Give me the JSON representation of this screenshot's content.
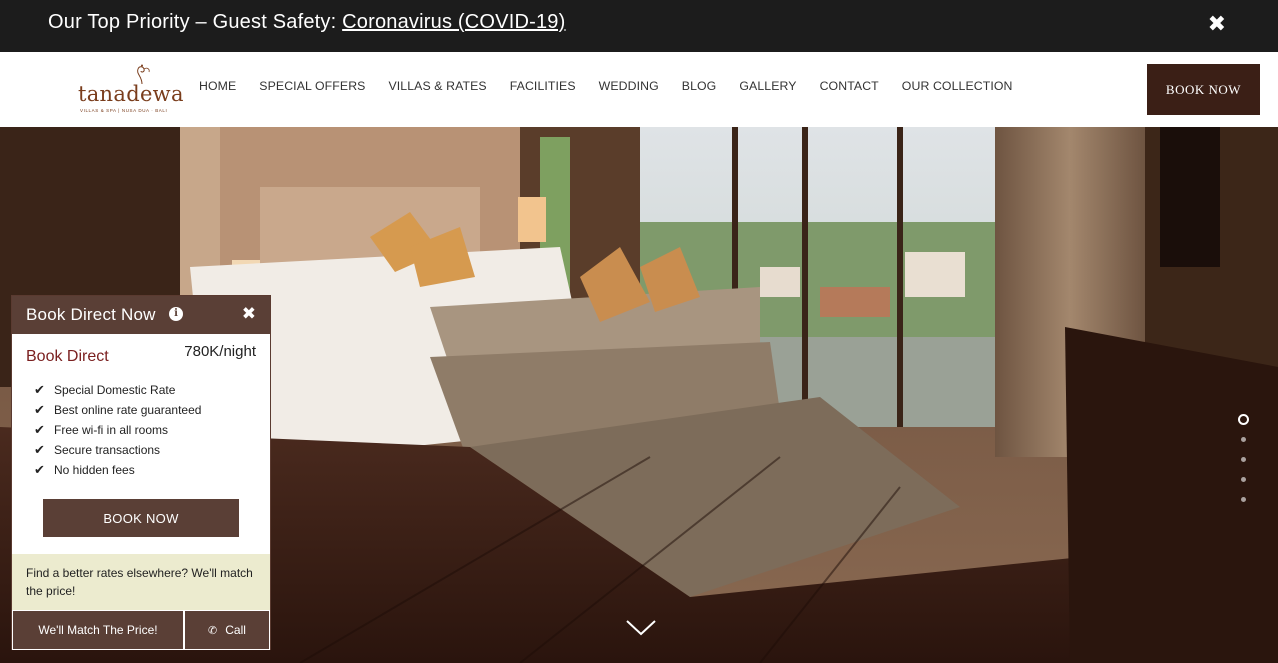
{
  "announcement": {
    "prefix": "Our Top Priority – Guest Safety: ",
    "link": "Coronavirus (COVID-19)",
    "close_icon": "close-icon"
  },
  "header": {
    "logo_text": "tanadewa",
    "logo_subtitle": "VILLAS & SPA | NUSA DUA · BALI",
    "nav": [
      "HOME",
      "SPECIAL OFFERS",
      "VILLAS & RATES",
      "FACILITIES",
      "WEDDING",
      "BLOG",
      "GALLERY",
      "CONTACT",
      "OUR COLLECTION"
    ],
    "book_label": "BOOK NOW"
  },
  "hero": {
    "slides_total": 5,
    "active_slide": 1,
    "scroll_icon": "chevron-down-icon"
  },
  "panel": {
    "title": "Book Direct Now",
    "info_glyph": "i",
    "heading": "Book Direct",
    "price": "780K/night",
    "features": [
      "Special Domestic Rate",
      "Best online rate guaranteed",
      "Free wi-fi in all rooms",
      "Secure transactions",
      "No hidden fees"
    ],
    "book_label": "BOOK NOW",
    "match_text": "Find a better rates elsewhere? We'll match the price!",
    "match_button": "We'll Match The Price!",
    "call_button": "Call"
  },
  "colors": {
    "topbar": "#1c1c1c",
    "brand_dark": "#3b1f16",
    "panel_brown": "#5a3f36",
    "book_direct_red": "#7a1f1f",
    "match_bg": "#ecebcf"
  }
}
